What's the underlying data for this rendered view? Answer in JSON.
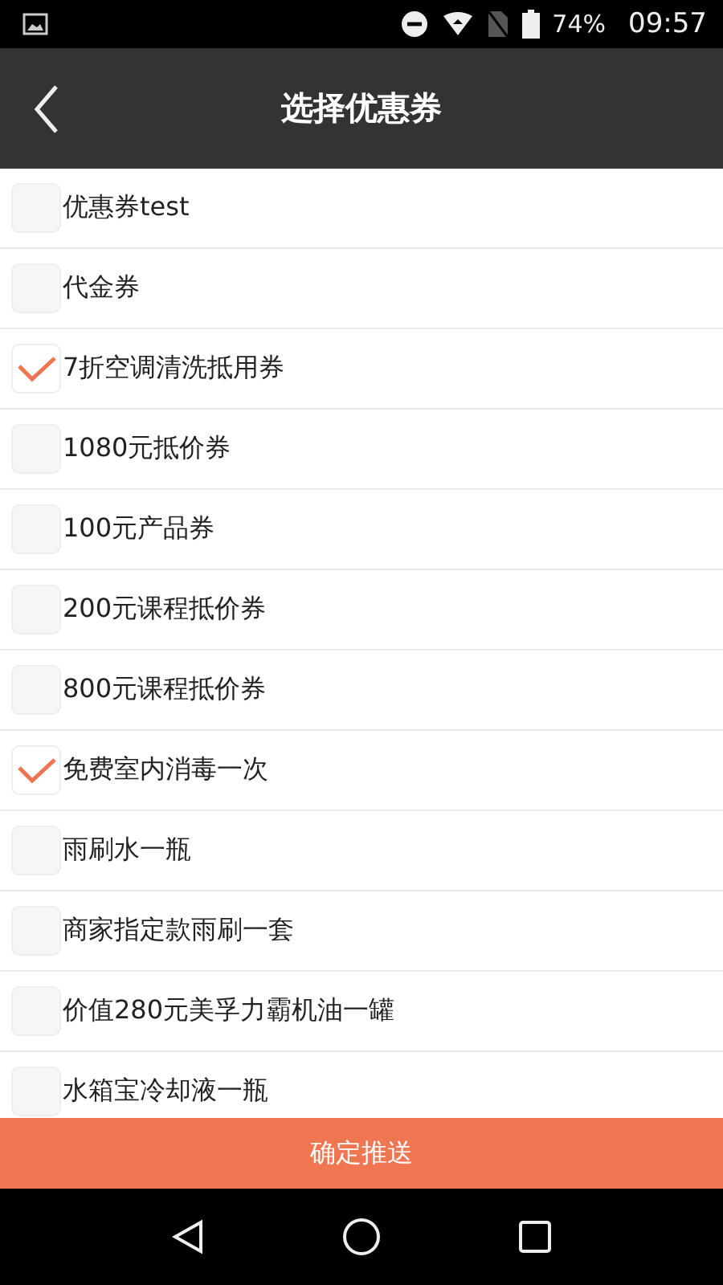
{
  "status_bar": {
    "battery": "74%",
    "time": "09:57"
  },
  "header": {
    "title": "选择优惠券"
  },
  "coupons": [
    {
      "label": "优惠券test",
      "checked": false
    },
    {
      "label": "代金券",
      "checked": false
    },
    {
      "label": "7折空调清洗抵用券",
      "checked": true
    },
    {
      "label": "1080元抵价券",
      "checked": false
    },
    {
      "label": "100元产品券",
      "checked": false
    },
    {
      "label": "200元课程抵价券",
      "checked": false
    },
    {
      "label": "800元课程抵价券",
      "checked": false
    },
    {
      "label": "免费室内消毒一次",
      "checked": true
    },
    {
      "label": "雨刷水一瓶",
      "checked": false
    },
    {
      "label": "商家指定款雨刷一套",
      "checked": false
    },
    {
      "label": "价值280元美孚力霸机油一罐",
      "checked": false
    },
    {
      "label": "水箱宝冷却液一瓶",
      "checked": false
    }
  ],
  "confirm_button": "确定推送"
}
